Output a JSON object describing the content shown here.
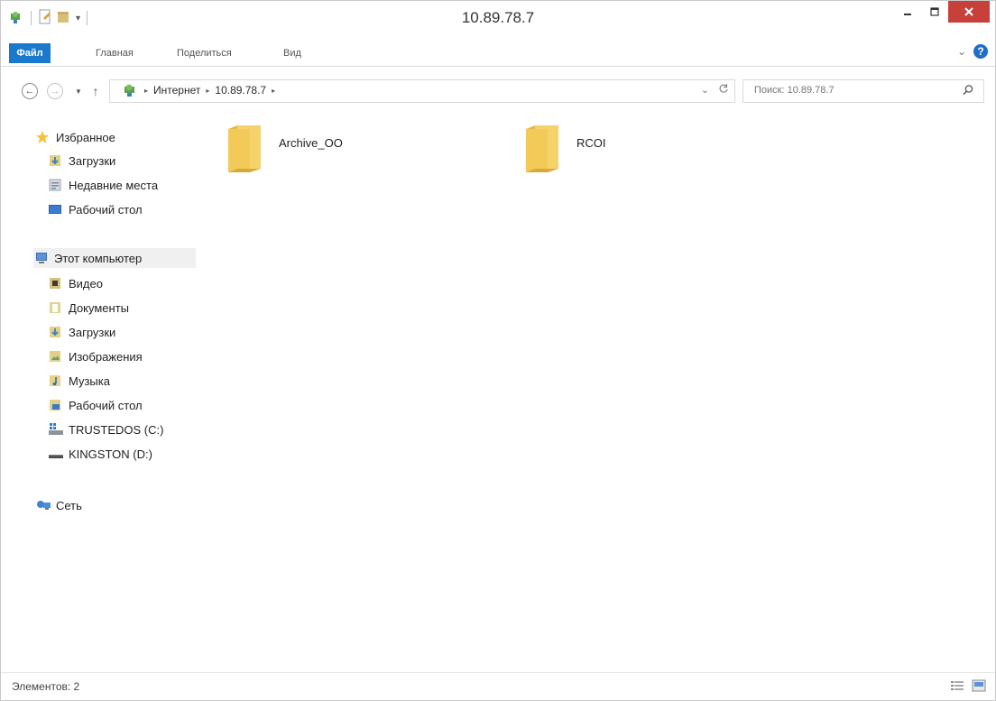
{
  "window": {
    "title": "10.89.78.7"
  },
  "ribbon": {
    "tabs": [
      "Файл",
      "Главная",
      "Поделиться",
      "Вид"
    ]
  },
  "address": {
    "segments": [
      "Интернет",
      "10.89.78.7"
    ]
  },
  "search": {
    "placeholder": "Поиск: 10.89.78.7"
  },
  "navigation": {
    "favorites": {
      "label": "Избранное",
      "items": [
        "Загрузки",
        "Недавние места",
        "Рабочий стол"
      ]
    },
    "computer": {
      "label": "Этот компьютер",
      "items": [
        "Видео",
        "Документы",
        "Загрузки",
        "Изображения",
        "Музыка",
        "Рабочий стол",
        "TRUSTEDOS (C:)",
        "KINGSTON (D:)"
      ]
    },
    "network": {
      "label": "Сеть"
    }
  },
  "content": {
    "folders": [
      "Archive_OO",
      "RCOI"
    ]
  },
  "status": {
    "items_text": "Элементов: 2"
  },
  "colors": {
    "accent": "#1979ca",
    "close": "#c7413a",
    "folder": "#f3cf5e"
  }
}
